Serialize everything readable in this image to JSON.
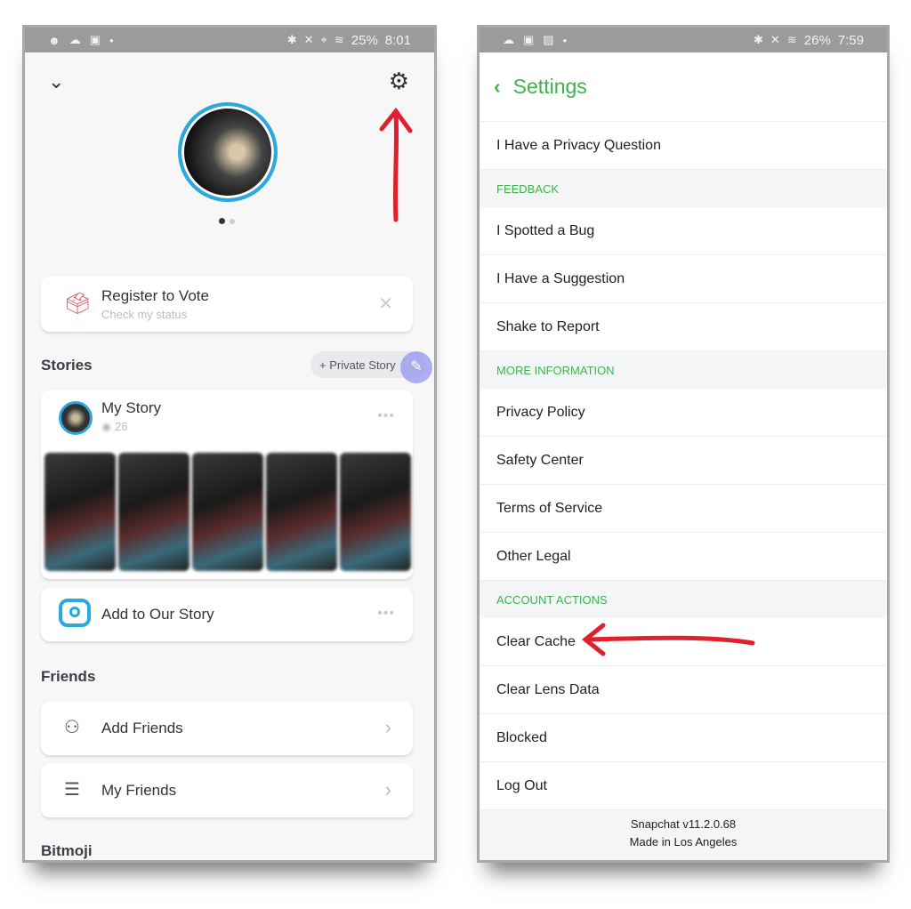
{
  "left_phone": {
    "status_bar": {
      "battery": "25%",
      "time": "8:01"
    },
    "register_card": {
      "title": "Register to Vote",
      "subtitle": "Check my status"
    },
    "stories_section": {
      "title": "Stories",
      "private_story_label": "+ Private Story"
    },
    "my_story": {
      "title": "My Story",
      "views": "26"
    },
    "add_to_our_story": {
      "label": "Add to Our Story"
    },
    "friends_section": {
      "title": "Friends"
    },
    "add_friends": {
      "label": "Add Friends"
    },
    "my_friends": {
      "label": "My Friends"
    },
    "bitmoji_section": {
      "title": "Bitmoji"
    }
  },
  "right_phone": {
    "status_bar": {
      "battery": "26%",
      "time": "7:59"
    },
    "title": "Settings",
    "items": [
      {
        "type": "row",
        "label": "I Have a Privacy Question"
      },
      {
        "type": "header",
        "label": "FEEDBACK"
      },
      {
        "type": "row",
        "label": "I Spotted a Bug"
      },
      {
        "type": "row",
        "label": "I Have a Suggestion"
      },
      {
        "type": "row",
        "label": "Shake to Report"
      },
      {
        "type": "header",
        "label": "MORE INFORMATION"
      },
      {
        "type": "row",
        "label": "Privacy Policy"
      },
      {
        "type": "row",
        "label": "Safety Center"
      },
      {
        "type": "row",
        "label": "Terms of Service"
      },
      {
        "type": "row",
        "label": "Other Legal"
      },
      {
        "type": "header",
        "label": "ACCOUNT ACTIONS"
      },
      {
        "type": "row",
        "label": "Clear Cache"
      },
      {
        "type": "row",
        "label": "Clear Lens Data"
      },
      {
        "type": "row",
        "label": "Blocked"
      },
      {
        "type": "row",
        "label": "Log Out"
      }
    ],
    "footer": {
      "version": "Snapchat v11.2.0.68",
      "made_in": "Made in Los Angeles"
    }
  },
  "colors": {
    "accent_green": "#3cb44b",
    "snap_blue": "#2aa9e0",
    "annotation_red": "#e0202a"
  }
}
